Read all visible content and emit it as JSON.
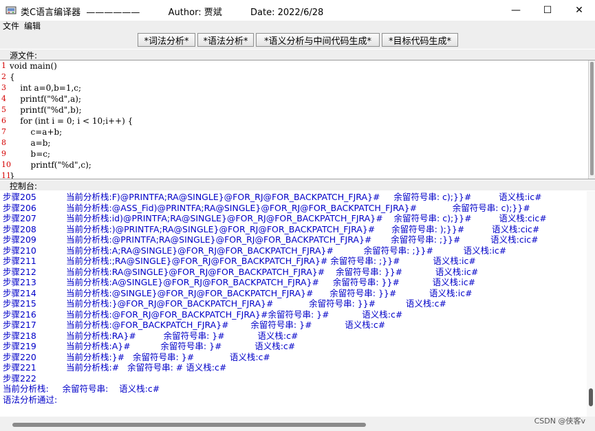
{
  "window": {
    "title": "类C语言编译器  ——————          Author: 贾斌          Date: 2022/6/28",
    "icon": "compiler-app-icon",
    "controls": [
      "—",
      "☐",
      "✕"
    ]
  },
  "menu": {
    "items": [
      "文件",
      "编辑"
    ]
  },
  "toolbar": {
    "buttons": [
      "*词法分析*",
      "*语法分析*",
      "*语义分析与中间代码生成*",
      "*目标代码生成*"
    ]
  },
  "source": {
    "label": "源文件:",
    "line_numbers": [
      "1",
      "2",
      "3",
      "4",
      "5",
      "6",
      "7",
      "8",
      "9",
      "10",
      "11"
    ],
    "lines": [
      "void main()",
      "{",
      "    int a=0,b=1,c;",
      "    printf(\"%d\",a);",
      "    printf(\"%d\",b);",
      "    for (int i = 0; i < 10;i++) {",
      "        c=a+b;",
      "        a=b;",
      "        b=c;",
      "        printf(\"%d\",c);",
      "}"
    ]
  },
  "console": {
    "label": "控制台:",
    "lines": [
      {
        "step": "步骤205",
        "text": "当前分析栈:F)@PRINTFA;RA@SINGLE}@FOR_RJ@FOR_BACKPATCH_FJRA}#     余留符号串: c);}}#          语义栈:ic#"
      },
      {
        "step": "步骤206",
        "text": "当前分析栈:@ASS_Fid)@PRINTFA;RA@SINGLE}@FOR_RJ@FOR_BACKPATCH_FJRA}#             余留符号串: c);}}#"
      },
      {
        "step": "步骤207",
        "text": "当前分析栈:id)@PRINTFA;RA@SINGLE}@FOR_RJ@FOR_BACKPATCH_FJRA}#    余留符号串: c);}}#          语义栈:cic#"
      },
      {
        "step": "步骤208",
        "text": "当前分析栈:)@PRINTFA;RA@SINGLE}@FOR_RJ@FOR_BACKPATCH_FJRA}#      余留符号串: );}}#          语义栈:cic#"
      },
      {
        "step": "步骤209",
        "text": "当前分析栈:@PRINTFA;RA@SINGLE}@FOR_RJ@FOR_BACKPATCH_FJRA}#       余留符号串: ;}}#           语义栈:cic#"
      },
      {
        "step": "步骤210",
        "text": "当前分析栈:A;RA@SINGLE}@FOR_RJ@FOR_BACKPATCH_FJRA}#           余留符号串: ;}}#           语义栈:ic#"
      },
      {
        "step": "步骤211",
        "text": "当前分析栈:;RA@SINGLE}@FOR_RJ@FOR_BACKPATCH_FJRA}# 余留符号串: ;}}#            语义栈:ic#"
      },
      {
        "step": "步骤212",
        "text": "当前分析栈:RA@SINGLE}@FOR_RJ@FOR_BACKPATCH_FJRA}#    余留符号串: }}#            语义栈:ic#"
      },
      {
        "step": "步骤213",
        "text": "当前分析栈:A@SINGLE}@FOR_RJ@FOR_BACKPATCH_FJRA}#     余留符号串: }}#            语义栈:ic#"
      },
      {
        "step": "步骤214",
        "text": "当前分析栈:@SINGLE}@FOR_RJ@FOR_BACKPATCH_FJRA}#      余留符号串: }}#            语义栈:ic#"
      },
      {
        "step": "步骤215",
        "text": "当前分析栈:}@FOR_RJ@FOR_BACKPATCH_FJRA}#             余留符号串: }}#           语义栈:c#"
      },
      {
        "step": "步骤216",
        "text": "当前分析栈:@FOR_RJ@FOR_BACKPATCH_FJRA}#余留符号串: }#            语义栈:c#"
      },
      {
        "step": "步骤217",
        "text": "当前分析栈:@FOR_BACKPATCH_FJRA}#        余留符号串: }#            语义栈:c#"
      },
      {
        "step": "步骤218",
        "text": "当前分析栈:RA}#          余留符号串: }#            语义栈:c#"
      },
      {
        "step": "步骤219",
        "text": "当前分析栈:A}#           余留符号串: }#            语义栈:c#"
      },
      {
        "step": "步骤220",
        "text": "当前分析栈:}#   余留符号串: }#             语义栈:c#"
      },
      {
        "step": "步骤221",
        "text": "当前分析栈:#   余留符号串: # 语义栈:c#"
      },
      {
        "step": "步骤222",
        "text": ""
      },
      {
        "step": "",
        "text": "当前分析栈:     余留符号串:    语义栈:c#"
      },
      {
        "step": "",
        "text": "语法分析通过:"
      }
    ]
  },
  "watermark": "CSDN @侠客v"
}
